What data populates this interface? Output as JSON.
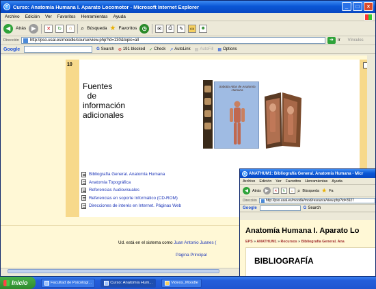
{
  "window1": {
    "title": "Curso: Anatomía Humana I. Aparato Locomotor - Microsoft Internet Explorer",
    "menu": [
      "Archivo",
      "Edición",
      "Ver",
      "Favoritos",
      "Herramientas",
      "Ayuda"
    ],
    "toolbar": {
      "back": "Atrás",
      "search": "Búsqueda",
      "favorites": "Favoritos"
    },
    "address_label": "Dirección",
    "address": "http://pso.usal.es/moodle/course/view.php?id=130&topic=all",
    "go_label": "Ir",
    "links_label": "Vínculos",
    "google_bar": {
      "logo": "Google",
      "search": "Search",
      "blocked": "191 blocked",
      "check": "Check",
      "autolink": "AutoLink",
      "autofill": "AutoFill",
      "options": "Options"
    }
  },
  "topic": {
    "number": "10",
    "heading": "Fuentes\n  de\ninformación\nadicionales",
    "book_title": "Sobotta Atlas de Anatomía Humana",
    "resources": [
      "Bibliografía General. Anatomía Humana",
      "Anatomía Topográfica",
      "Referencias Audiovisuales",
      "Referencias en soporte Informático (CD-ROM)",
      "Direcciones de interés en Internet. Páginas Web"
    ]
  },
  "footer": {
    "logged_prefix": "Ud. está en el sistema como",
    "user": "Juan Antonio Juanes (",
    "home": "Página Principal"
  },
  "window2": {
    "title": "ANATHUM1: Bibliografía General. Anatomía Humana - Micr",
    "menu": [
      "Archivo",
      "Edición",
      "Ver",
      "Favoritos",
      "Herramientas",
      "Ayuda"
    ],
    "toolbar": {
      "back": "Atrás",
      "search": "Búsqueda",
      "favorites": "Fa"
    },
    "address_label": "Dirección",
    "address": "http://pso.usal.es/moodle/mod/resource/view.php?id=3927",
    "google_logo": "Google",
    "google_search": "Search",
    "page_title": "Anatomía Humana I. Aparato Lo",
    "breadcrumb": [
      "EPS",
      "ANATHUM1",
      "Recursos",
      "Bibliografía General. Ana"
    ],
    "section": "BIBLIOGRAFÍA"
  },
  "taskbar": {
    "start": "Inicio",
    "items": [
      "Facultad de Psicologí...",
      "Curso: Anatomía Hum...",
      "Videos_Moodle"
    ]
  },
  "colors": {
    "titlebar": "#0a57d6",
    "page_bg": "#fff8d6",
    "topic_side": "#f7d98b",
    "link": "#1c35b8"
  }
}
